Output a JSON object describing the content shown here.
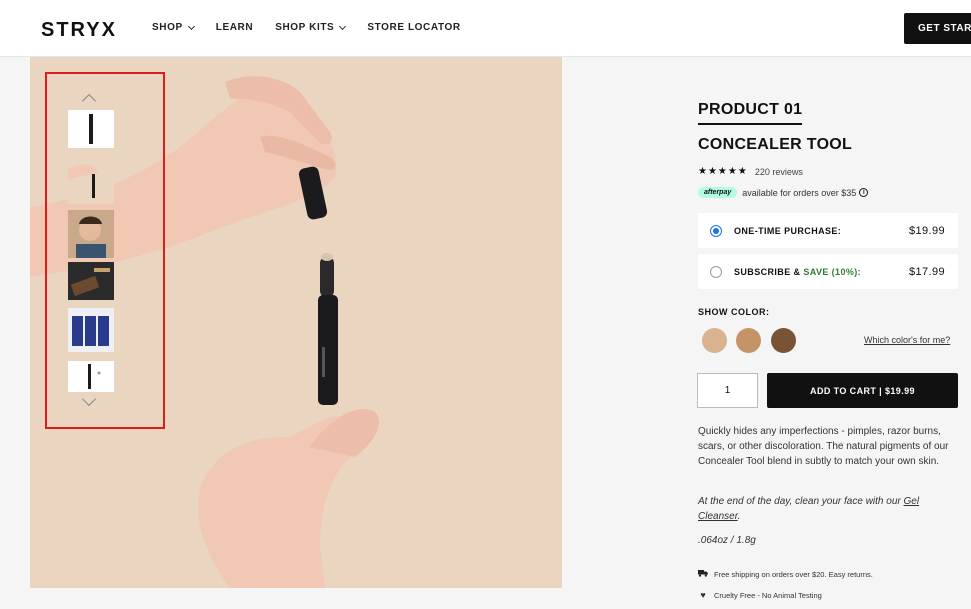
{
  "header": {
    "logo": "STRYX",
    "nav": [
      {
        "label": "SHOP",
        "dropdown": true
      },
      {
        "label": "LEARN",
        "dropdown": false
      },
      {
        "label": "SHOP KITS",
        "dropdown": true
      },
      {
        "label": "STORE LOCATOR",
        "dropdown": false
      }
    ],
    "cta": "GET STARTED"
  },
  "gallery": {
    "thumbnails": [
      "product-pen-thumb",
      "hands-pen-thumb",
      "man-applying-thumb",
      "flatlay-thumb",
      "three-pack-thumb",
      "pen-cap-thumb"
    ]
  },
  "product": {
    "number": "PRODUCT 01",
    "name": "CONCEALER TOOL",
    "stars": "★★★★★",
    "reviews": "220 reviews",
    "afterpay_badge": "afterpay",
    "afterpay_text": "available for orders over $35",
    "info_icon": "i",
    "options": [
      {
        "label": "ONE-TIME PURCHASE:",
        "price": "$19.99",
        "selected": true
      },
      {
        "label_prefix": "SUBSCRIBE & ",
        "label_save": "SAVE (10%):",
        "price": "$17.99",
        "selected": false
      }
    ],
    "color_label": "SHOW COLOR:",
    "colors": [
      "#d9b28f",
      "#c49467",
      "#7a5236"
    ],
    "which_color": "Which color's for me?",
    "quantity": "1",
    "add_to_cart": "ADD TO CART | $19.99",
    "description": "Quickly hides any imperfections - pimples, razor burns, scars, or other discoloration. The natural pigments of our Concealer Tool blend in subtly to match your own skin.",
    "tip_prefix": "At the end of the day, clean your face with our ",
    "tip_link": "Gel Cleanser",
    "tip_suffix": ".",
    "weight": ".064oz / 1.8g",
    "perks": [
      {
        "icon": "truck-icon",
        "text": "Free shipping on orders over $20. Easy returns."
      },
      {
        "icon": "heart-icon",
        "text": "Cruelty Free - No Animal Testing"
      }
    ]
  }
}
